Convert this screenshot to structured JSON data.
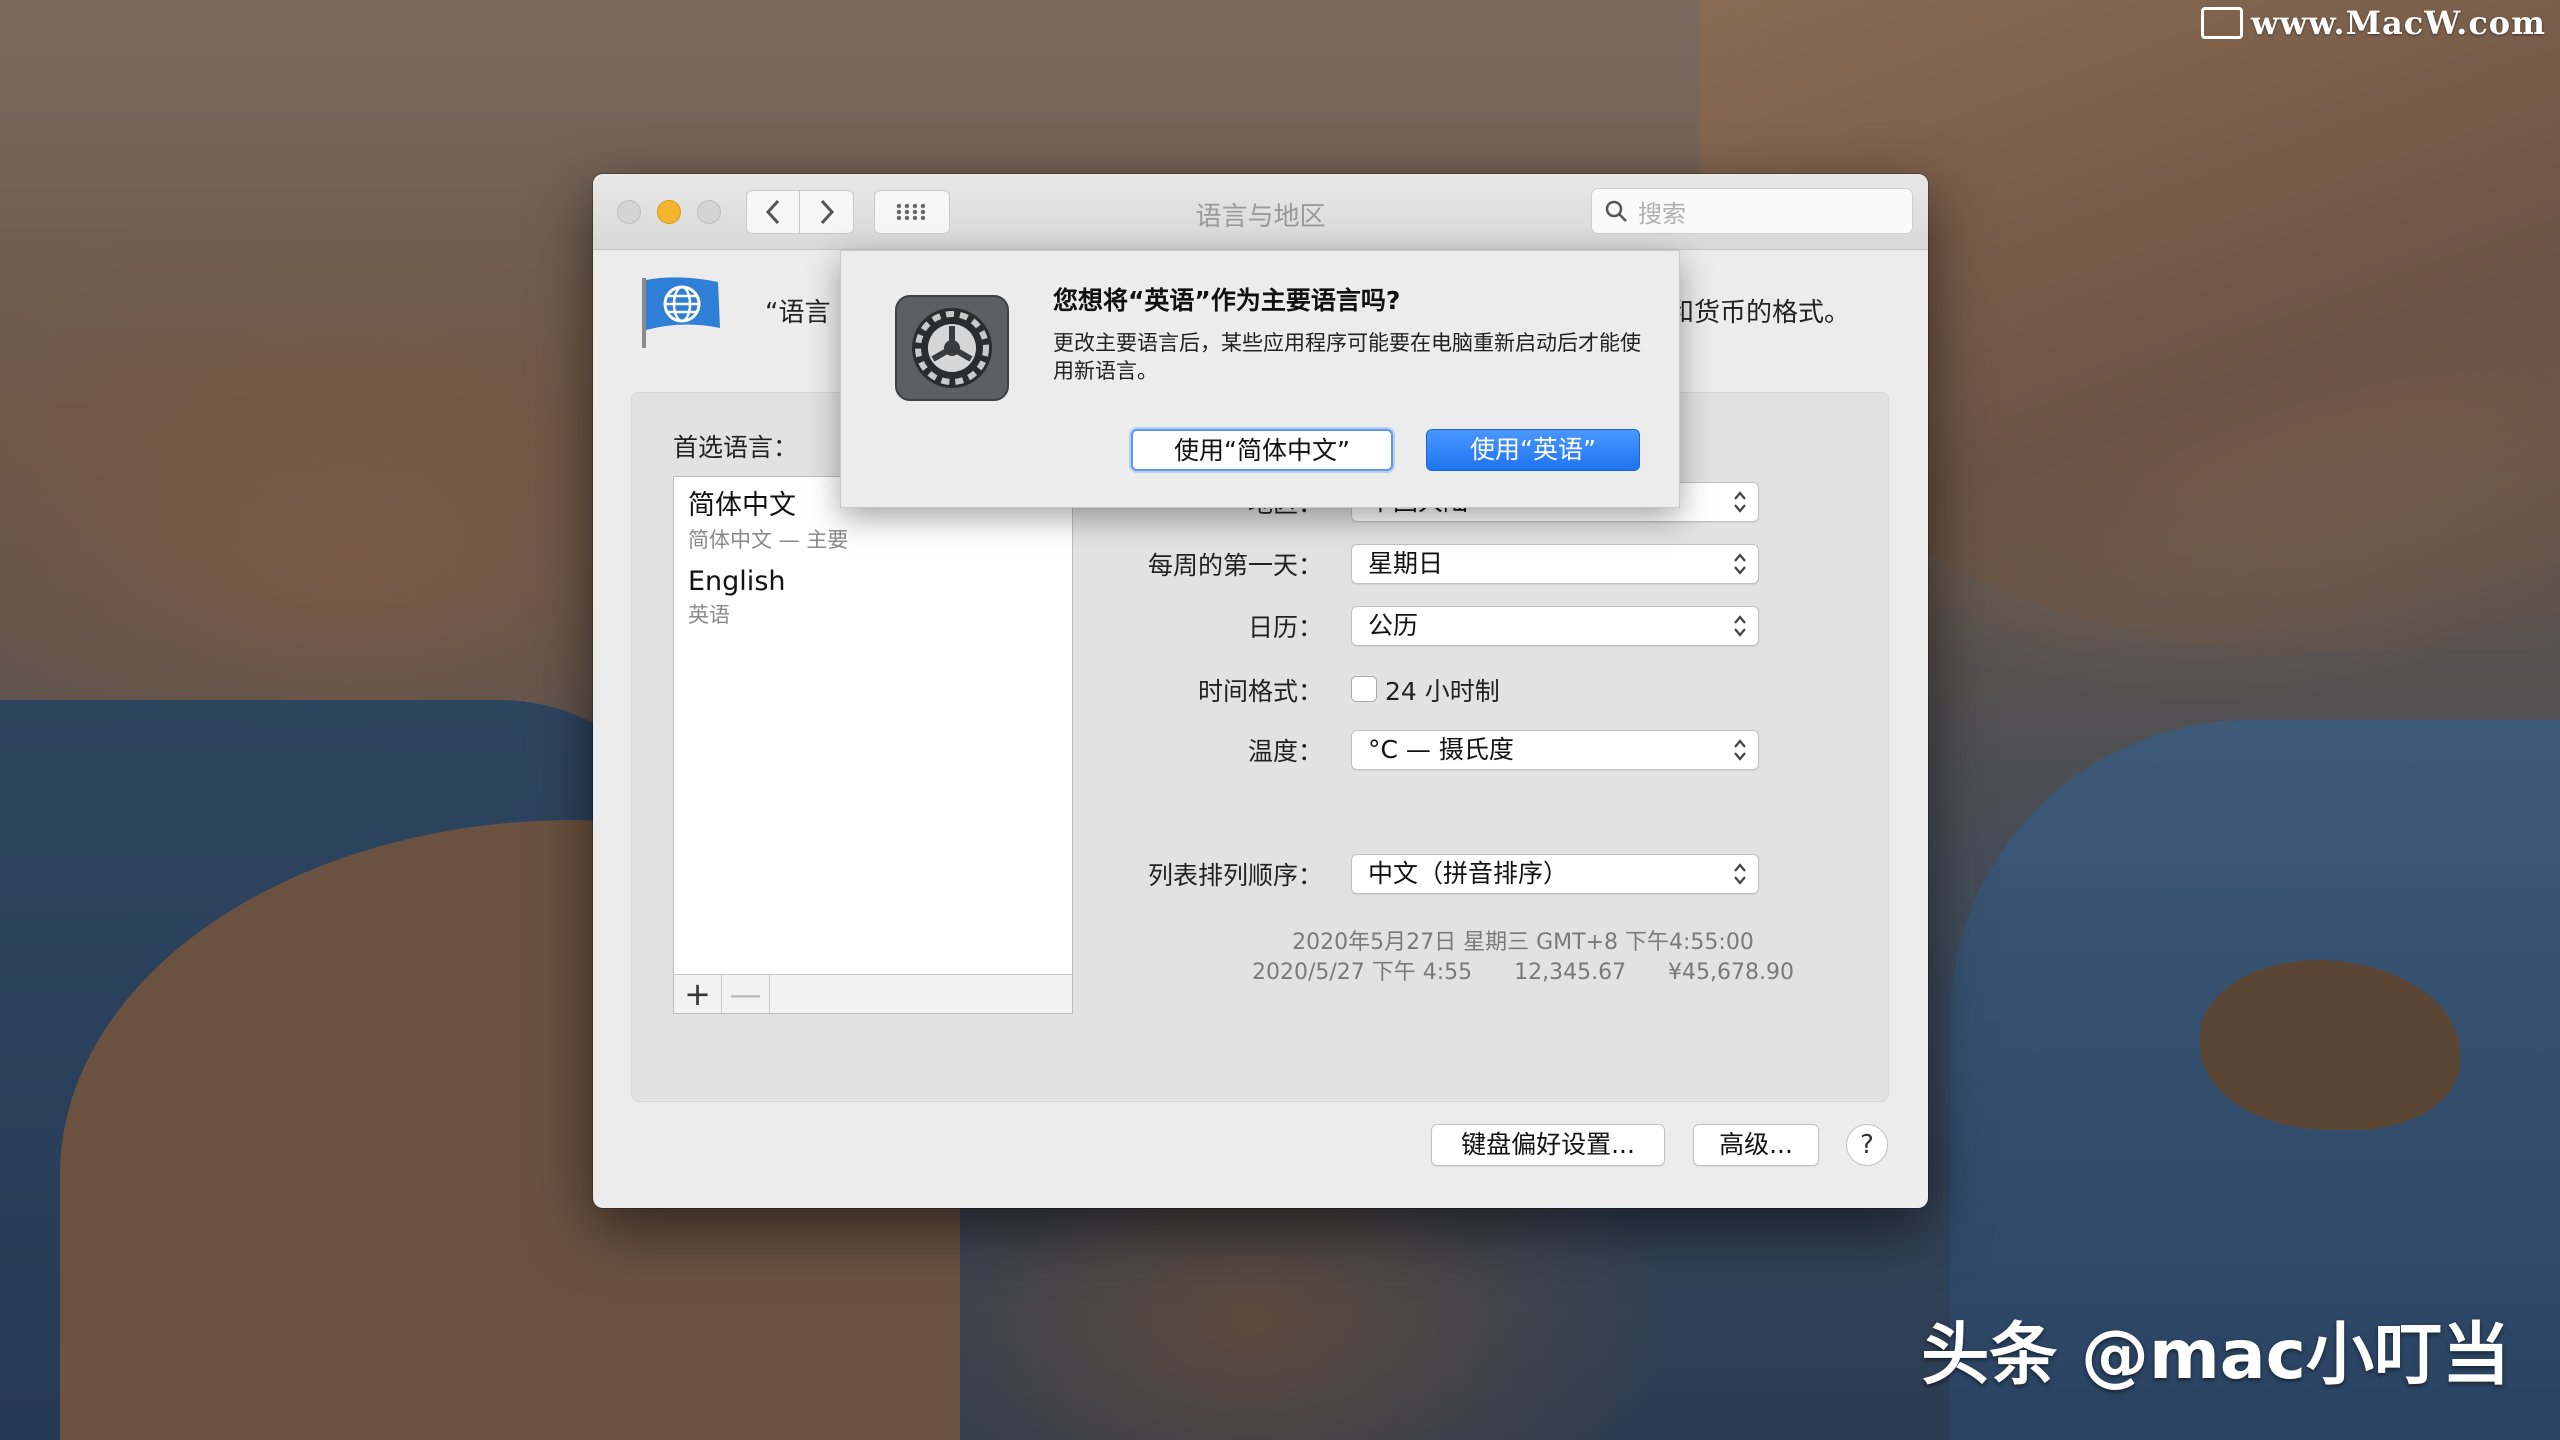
{
  "watermark_top": "www.MacW.com",
  "watermark_bottom": "头条 @mac小叮当",
  "window": {
    "title": "语言与地区",
    "search_placeholder": "搜索",
    "description_left": "“语言",
    "description_right": "和货币的格式。"
  },
  "languages": {
    "label": "首选语言：",
    "items": [
      {
        "name": "简体中文",
        "sub": "简体中文 — 主要"
      },
      {
        "name": "English",
        "sub": "英语"
      }
    ],
    "add_button": "+",
    "remove_button": "—"
  },
  "settings": {
    "region": {
      "label": "地区：",
      "value": "中国大陆"
    },
    "first_day": {
      "label": "每周的第一天：",
      "value": "星期日"
    },
    "calendar": {
      "label": "日历：",
      "value": "公历"
    },
    "time_format": {
      "label": "时间格式：",
      "checkbox_label": "24 小时制",
      "checked": false
    },
    "temperature": {
      "label": "温度：",
      "value": "°C — 摄氏度"
    },
    "sort_order": {
      "label": "列表排列顺序：",
      "value": "中文（拼音排序）"
    }
  },
  "sample": {
    "line1": "2020年5月27日 星期三 GMT+8 下午4:55:00",
    "line2": "2020/5/27 下午 4:55      12,345.67      ¥45,678.90"
  },
  "footer": {
    "keyboard_button": "键盘偏好设置...",
    "advanced_button": "高级...",
    "help_button": "?"
  },
  "alert": {
    "title": "您想将“英语”作为主要语言吗?",
    "message": "更改主要语言后，某些应用程序可能要在电脑重新启动后才能使用新语言。",
    "secondary_button": "使用“简体中文”",
    "primary_button": "使用“英语”"
  },
  "colors": {
    "accent": "#1f74f0",
    "minimize": "#f5b52f"
  },
  "icons": {
    "flag": "globe-flag-icon",
    "alert": "system-preferences-gear-icon",
    "search": "search-icon"
  }
}
